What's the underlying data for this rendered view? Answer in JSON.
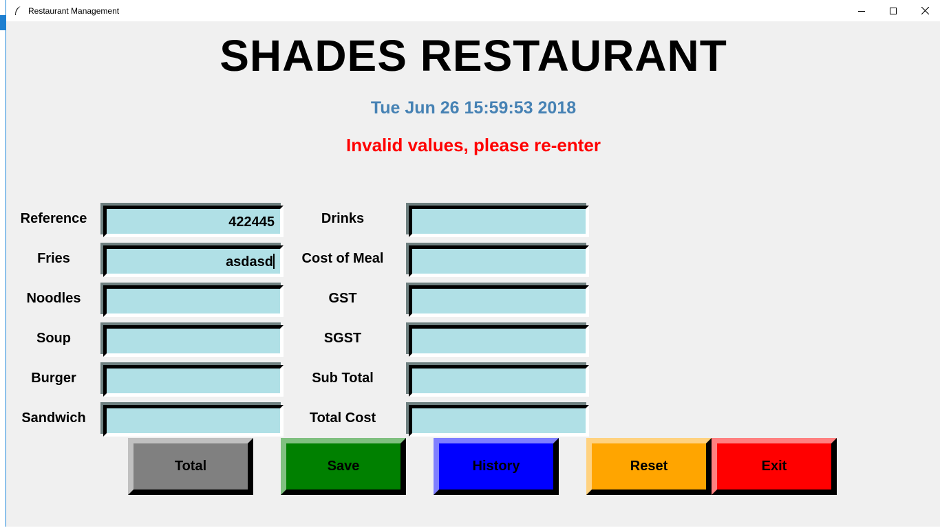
{
  "window": {
    "title": "Restaurant Management"
  },
  "header": {
    "title": "SHADES RESTAURANT",
    "datetime": "Tue Jun 26 15:59:53 2018",
    "error_message": "Invalid values, please re-enter"
  },
  "left_fields": {
    "reference": {
      "label": "Reference",
      "value": "422445"
    },
    "fries": {
      "label": "Fries",
      "value": "asdasd"
    },
    "noodles": {
      "label": "Noodles",
      "value": ""
    },
    "soup": {
      "label": "Soup",
      "value": ""
    },
    "burger": {
      "label": "Burger",
      "value": ""
    },
    "sandwich": {
      "label": "Sandwich",
      "value": ""
    }
  },
  "right_fields": {
    "drinks": {
      "label": "Drinks",
      "value": ""
    },
    "cost_of_meal": {
      "label": "Cost of Meal",
      "value": ""
    },
    "gst": {
      "label": "GST",
      "value": ""
    },
    "sgst": {
      "label": "SGST",
      "value": ""
    },
    "sub_total": {
      "label": "Sub Total",
      "value": ""
    },
    "total_cost": {
      "label": "Total Cost",
      "value": ""
    }
  },
  "buttons": {
    "total": {
      "label": "Total",
      "color": "#808080"
    },
    "save": {
      "label": "Save",
      "color": "#008000"
    },
    "history": {
      "label": "History",
      "color": "#0000ff"
    },
    "reset": {
      "label": "Reset",
      "color": "#ffa500"
    },
    "exit": {
      "label": "Exit",
      "color": "#ff0000"
    }
  },
  "colors": {
    "window_bg": "#f0f0f0",
    "entry_bg": "#b0e0e6",
    "datetime": "#4682b4",
    "error": "#ff0000"
  }
}
